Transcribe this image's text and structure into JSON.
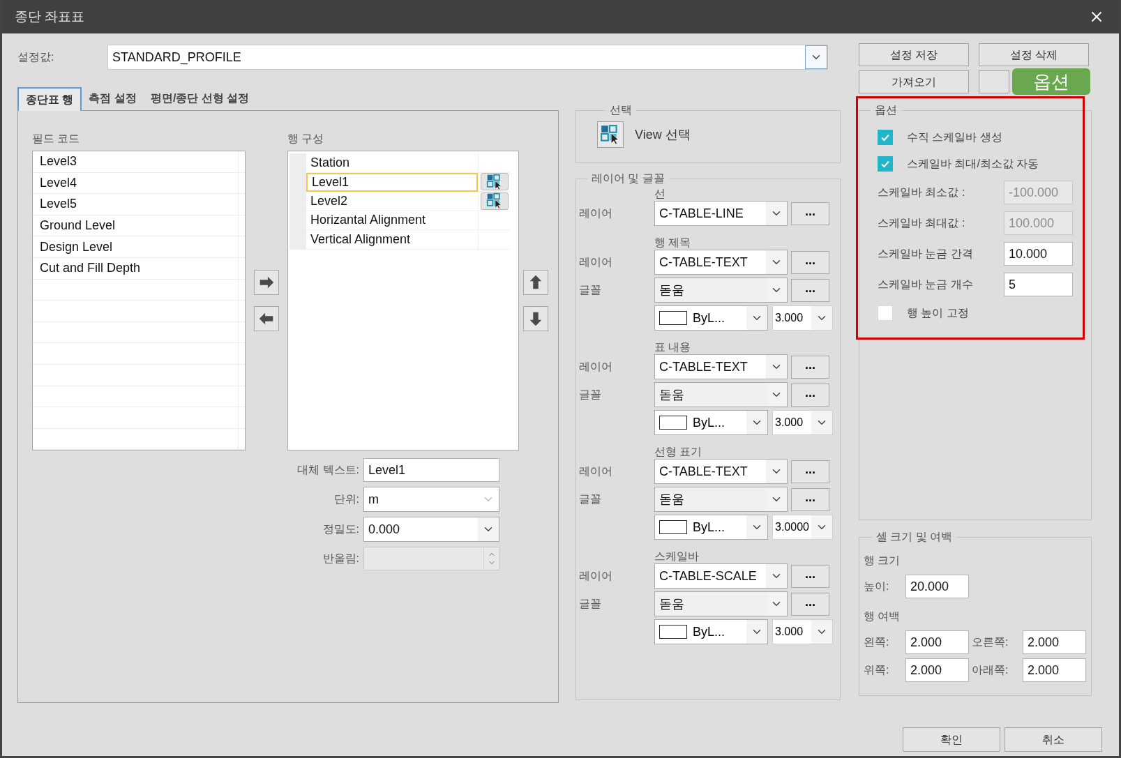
{
  "window": {
    "title": "종단 좌표표"
  },
  "preset": {
    "label": "설정값:",
    "value": "STANDARD_PROFILE"
  },
  "preset_buttons": [
    {
      "label": "설정 저장"
    },
    {
      "label": "설정 삭제"
    },
    {
      "label": "가져오기"
    }
  ],
  "tabs": [
    {
      "label": "종단표 행",
      "selected": true
    },
    {
      "label": "측점 설정",
      "selected": false
    },
    {
      "label": "평면/종단 선형 설정",
      "selected": false
    }
  ],
  "field_codes": {
    "label": "필드 코드",
    "items": [
      "Level3",
      "Level4",
      "Level5",
      "Ground Level",
      "Design Level",
      "Cut and Fill Depth"
    ]
  },
  "row_config": {
    "label": "행 구성",
    "rows": [
      {
        "label": "Station",
        "selected": false,
        "view_button": false
      },
      {
        "label": "Level1",
        "selected": true,
        "view_button": true
      },
      {
        "label": "Level2",
        "selected": false,
        "view_button": true
      },
      {
        "label": "Horizantal Alignment",
        "selected": false,
        "view_button": false
      },
      {
        "label": "Vertical Alignment",
        "selected": false,
        "view_button": false
      }
    ]
  },
  "row_props": [
    {
      "kind": "text",
      "label": "대체 텍스트:",
      "value": "Level1",
      "disabled": false
    },
    {
      "kind": "combo",
      "label": "단위:",
      "value": "m",
      "disabled": true
    },
    {
      "kind": "combo",
      "label": "정밀도:",
      "value": "0.000",
      "disabled": false
    },
    {
      "kind": "spin",
      "label": "반올림:",
      "disabled": true
    }
  ],
  "selection": {
    "title": "선택",
    "button": "View 선택"
  },
  "layer_font": {
    "title": "레이어 및 글꼴",
    "sections": [
      {
        "title": "선",
        "rows": [
          {
            "kind": "layer",
            "label": "레이어",
            "value": "C-TABLE-LINE",
            "button": "..."
          }
        ]
      },
      {
        "title": "행 제목",
        "rows": [
          {
            "kind": "layer",
            "label": "레이어",
            "value": "C-TABLE-TEXT",
            "button": "..."
          },
          {
            "kind": "font",
            "label": "글꼴",
            "value": "돋움",
            "button": "..."
          },
          {
            "kind": "color",
            "value": "ByL...",
            "size": "3.000"
          }
        ]
      },
      {
        "title": "표 내용",
        "rows": [
          {
            "kind": "layer",
            "label": "레이어",
            "value": "C-TABLE-TEXT",
            "button": "..."
          },
          {
            "kind": "font",
            "label": "글꼴",
            "value": "돋움",
            "button": "..."
          },
          {
            "kind": "color",
            "value": "ByL...",
            "size": "3.000"
          }
        ]
      },
      {
        "title": "선형 표기",
        "rows": [
          {
            "kind": "layer",
            "label": "레이어",
            "value": "C-TABLE-TEXT",
            "button": "..."
          },
          {
            "kind": "font",
            "label": "글꼴",
            "value": "돋움",
            "button": "..."
          },
          {
            "kind": "color",
            "value": "ByL...",
            "size": "3.0000"
          }
        ]
      },
      {
        "title": "스케일바",
        "rows": [
          {
            "kind": "layer",
            "label": "레이어",
            "value": "C-TABLE-SCALE",
            "button": "..."
          },
          {
            "kind": "font",
            "label": "글꼴",
            "value": "돋움",
            "button": "..."
          },
          {
            "kind": "color",
            "value": "ByL...",
            "size": "3.000"
          }
        ]
      }
    ]
  },
  "options": {
    "title": "옵션",
    "items": [
      {
        "kind": "checkbox",
        "label": "수직 스케일바 생성",
        "checked": true
      },
      {
        "kind": "checkbox",
        "label": "스케일바 최대/최소값 자동",
        "checked": true
      },
      {
        "kind": "field",
        "label": "스케일바 최소값 :",
        "value": "-100.000",
        "disabled": true
      },
      {
        "kind": "field",
        "label": "스케일바 최대값 :",
        "value": "100.000",
        "disabled": true
      },
      {
        "kind": "field",
        "label": "스케일바 눈금 간격",
        "value": "10.000",
        "disabled": false
      },
      {
        "kind": "field",
        "label": "스케일바 눈금 개수",
        "value": "5",
        "disabled": false
      },
      {
        "kind": "checkbox",
        "label": "행 높이 고정",
        "checked": false
      }
    ]
  },
  "cell_size": {
    "title": "셀 크기 및 여백",
    "row_size_label": "행 크기",
    "height": {
      "label": "높이:",
      "value": "20.000"
    },
    "margin_label": "행 여백",
    "margins": [
      {
        "label": "왼쪽:",
        "value": "2.000"
      },
      {
        "label": "오른쪽:",
        "value": "2.000"
      },
      {
        "label": "위쪽:",
        "value": "2.000"
      },
      {
        "label": "아래쪽:",
        "value": "2.000"
      }
    ]
  },
  "callout": {
    "label": "옵션"
  },
  "footer_buttons": [
    "확인",
    "취소"
  ]
}
